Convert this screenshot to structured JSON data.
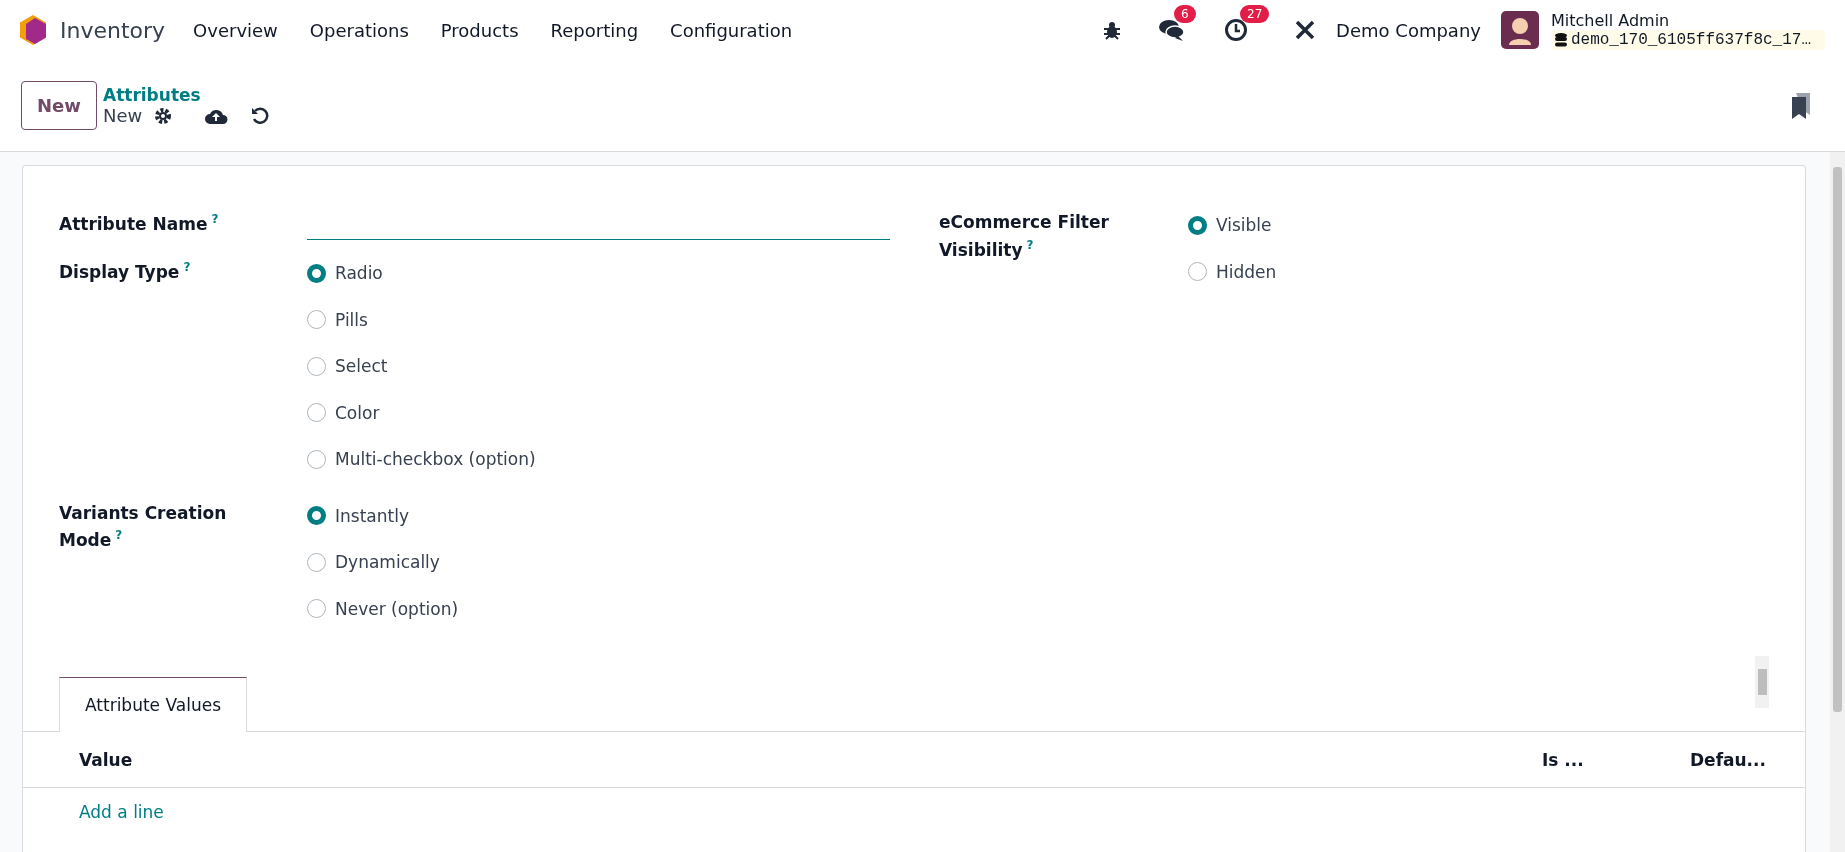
{
  "navbar": {
    "app_name": "Inventory",
    "menu": [
      "Overview",
      "Operations",
      "Products",
      "Reporting",
      "Configuration"
    ],
    "messages_badge": "6",
    "activities_badge": "27",
    "company": "Demo Company",
    "user_name": "Mitchell Admin",
    "database": "demo_170_6105ff637f8c_17…"
  },
  "control_panel": {
    "new_button": "New",
    "breadcrumb": "Attributes",
    "record": "New"
  },
  "form": {
    "left": [
      {
        "kind": "input",
        "label": "Attribute Name",
        "help": "?"
      },
      {
        "kind": "radio",
        "label": "Display Type",
        "help": "?",
        "options": [
          {
            "label": "Radio",
            "selected": true
          },
          {
            "label": "Pills",
            "selected": false
          },
          {
            "label": "Select",
            "selected": false
          },
          {
            "label": "Color",
            "selected": false
          },
          {
            "label": "Multi-checkbox (option)",
            "selected": false
          }
        ]
      },
      {
        "kind": "radio",
        "label": "Variants Creation Mode",
        "help": "?",
        "options": [
          {
            "label": "Instantly",
            "selected": true
          },
          {
            "label": "Dynamically",
            "selected": false
          },
          {
            "label": "Never (option)",
            "selected": false
          }
        ]
      }
    ],
    "right": [
      {
        "kind": "radio",
        "label": "eCommerce Filter Visibility",
        "help": "?",
        "options": [
          {
            "label": "Visible",
            "selected": true
          },
          {
            "label": "Hidden",
            "selected": false
          }
        ]
      }
    ]
  },
  "tabs": [
    {
      "label": "Attribute Values",
      "selected": true
    }
  ],
  "table": {
    "columns": [
      "Value",
      "Is ...",
      "Defau..."
    ],
    "add_line": "Add a line"
  }
}
